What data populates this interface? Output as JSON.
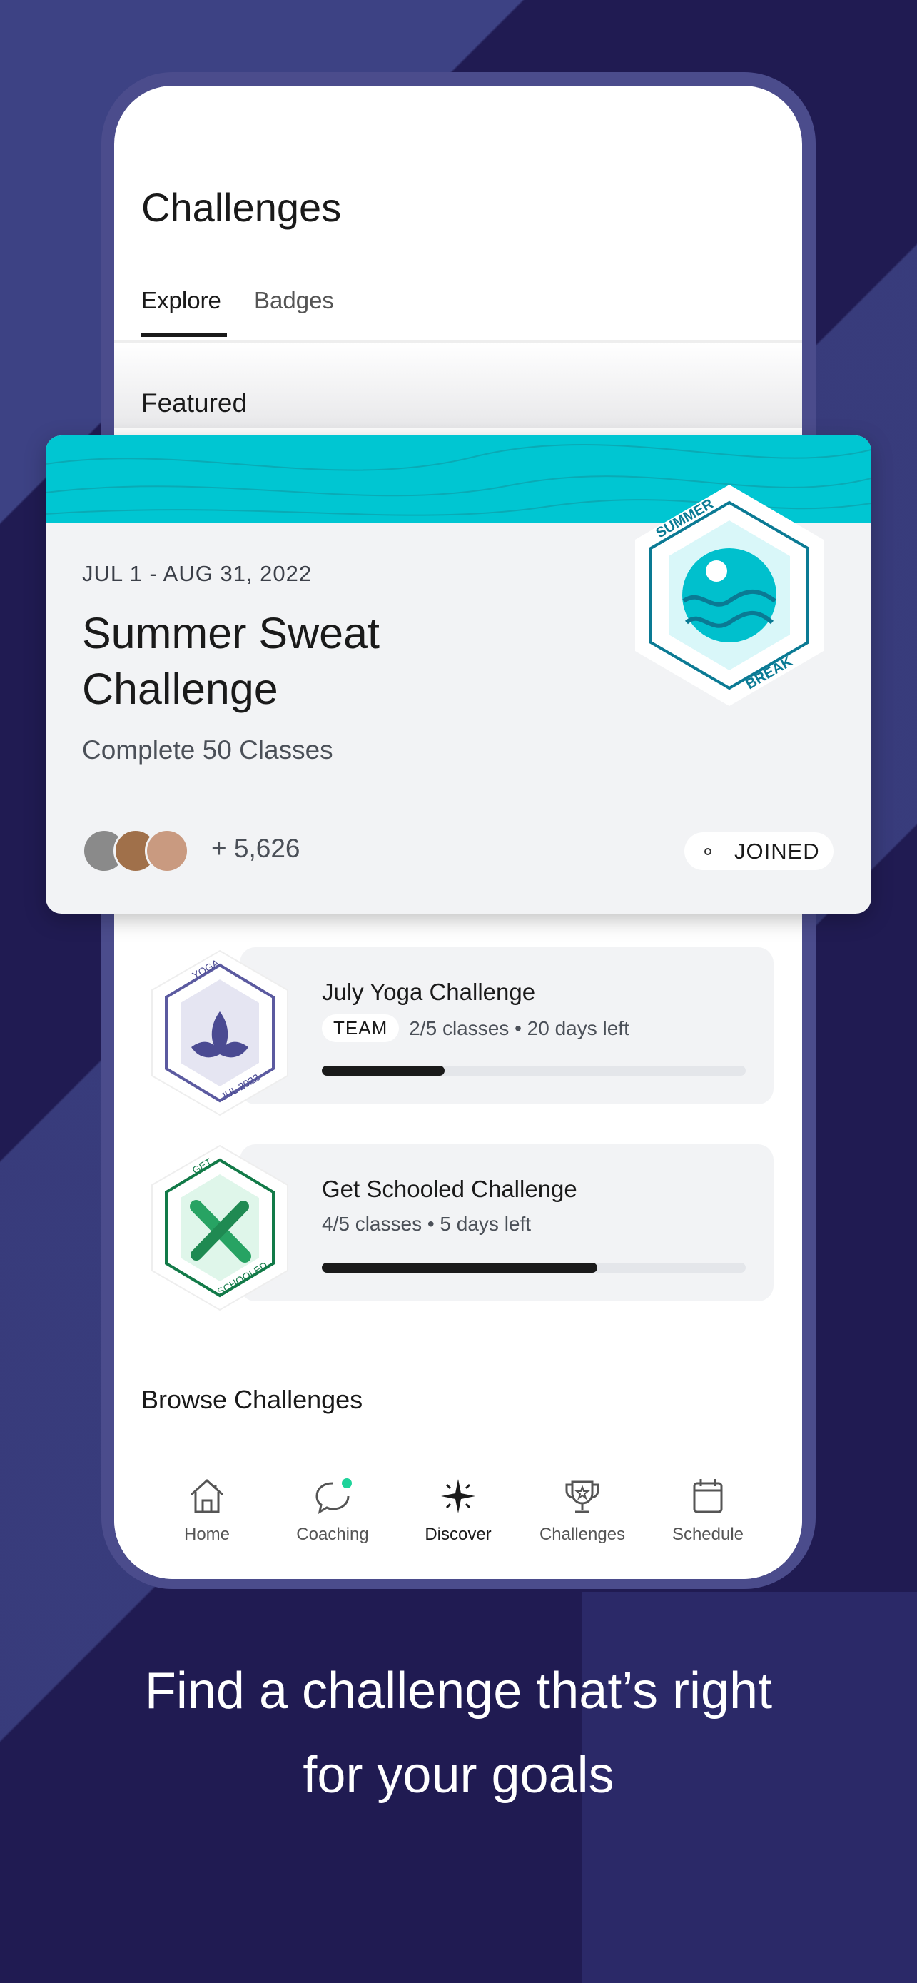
{
  "header": {
    "title": "Challenges"
  },
  "tabs": [
    {
      "label": "Explore",
      "active": true
    },
    {
      "label": "Badges",
      "active": false
    }
  ],
  "featured": {
    "section_label": "Featured",
    "date_range": "JUL 1 - AUG 31, 2022",
    "title": "Summer Sweat Challenge",
    "subtitle": "Complete 50 Classes",
    "participants": "+ 5,626",
    "status": "JOINED",
    "badge": {
      "top_text": "SUMMER",
      "bottom_text": "BREAK"
    },
    "accent": "#00c6d2"
  },
  "challenges": [
    {
      "title": "July Yoga Challenge",
      "tag": "TEAM",
      "meta": "2/5 classes • 20 days left",
      "progress": 0.29,
      "badge": {
        "top_text": "YOGA",
        "bottom_text": "JUL 2022",
        "icon": "lotus-icon"
      }
    },
    {
      "title": "Get Schooled Challenge",
      "meta": "4/5 classes • 5 days left",
      "progress": 0.65,
      "badge": {
        "top_text": "GET",
        "bottom_text": "SCHOOLED",
        "icon": "pencil-ruler-icon"
      }
    }
  ],
  "browse": {
    "title": "Browse Challenges"
  },
  "nav": [
    {
      "label": "Home",
      "icon": "home-icon"
    },
    {
      "label": "Coaching",
      "icon": "chat-icon"
    },
    {
      "label": "Discover",
      "icon": "sparkle-icon",
      "active": true
    },
    {
      "label": "Challenges",
      "icon": "trophy-icon"
    },
    {
      "label": "Schedule",
      "icon": "calendar-icon"
    }
  ],
  "caption": {
    "line1": "Find a challenge that’s right",
    "line2": "for your goals"
  }
}
